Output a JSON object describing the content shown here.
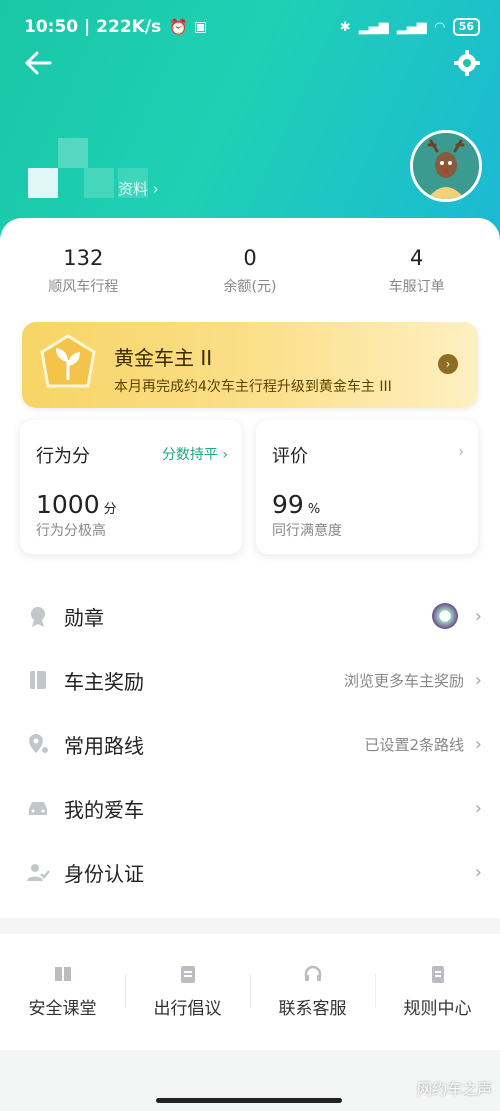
{
  "status_bar": {
    "time_speed": "10:50 | 222K/s",
    "battery": "56"
  },
  "profile": {
    "name_suffix": "资料 ›"
  },
  "stats": [
    {
      "value": "132",
      "label": "顺风车行程"
    },
    {
      "value": "0",
      "label": "余额(元)"
    },
    {
      "value": "4",
      "label": "车服订单"
    }
  ],
  "gold_card": {
    "title": "黄金车主 II",
    "subtitle": "本月再完成约4次车主行程升级到黄金车主 III"
  },
  "score_tile": {
    "title": "行为分",
    "action": "分数持平 ›",
    "value": "1000",
    "unit": "分",
    "desc": "行为分极高"
  },
  "rating_tile": {
    "title": "评价",
    "value": "99",
    "unit": "%",
    "desc": "同行满意度"
  },
  "menu": [
    {
      "label": "勋章",
      "right": ""
    },
    {
      "label": "车主奖励",
      "right": "浏览更多车主奖励"
    },
    {
      "label": "常用路线",
      "right": "已设置2条路线"
    },
    {
      "label": "我的爱车",
      "right": ""
    },
    {
      "label": "身份认证",
      "right": ""
    }
  ],
  "bottom_nav": [
    {
      "label": "安全课堂"
    },
    {
      "label": "出行倡议"
    },
    {
      "label": "联系客服"
    },
    {
      "label": "规则中心"
    }
  ],
  "watermark": "网约车之声",
  "colors": {
    "header_start": "#19c7a6",
    "header_end": "#1bb8d6",
    "accent_green": "#1ea783",
    "gold": "#f7d465"
  }
}
